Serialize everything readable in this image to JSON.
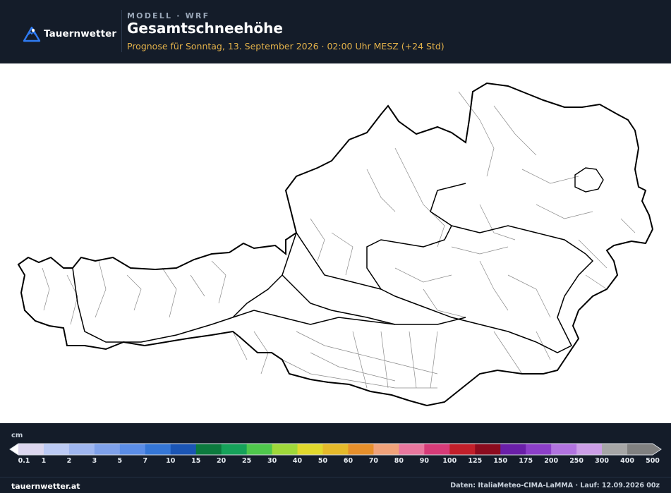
{
  "header": {
    "brand": "Tauernwetter",
    "model_label": "MODELL · WRF",
    "title": "Gesamtschneehöhe",
    "subtitle": "Prognose für Sonntag, 13. September 2026 · 02:00 Uhr MESZ  (+24 Std)"
  },
  "legend": {
    "unit": "cm",
    "ticks": [
      "0.1",
      "1",
      "2",
      "3",
      "5",
      "7",
      "10",
      "15",
      "20",
      "25",
      "30",
      "40",
      "50",
      "60",
      "70",
      "80",
      "90",
      "100",
      "125",
      "150",
      "175",
      "200",
      "250",
      "300",
      "400",
      "500"
    ],
    "colors": [
      "#dcd6ee",
      "#bccaf4",
      "#9fb6ef",
      "#7fa1ea",
      "#5b8de6",
      "#3576d6",
      "#1b55b4",
      "#0c7a3e",
      "#16a25a",
      "#4fc74c",
      "#9fd83a",
      "#e1d82c",
      "#e5b92a",
      "#e68f2b",
      "#f0a27a",
      "#e8779e",
      "#d63b78",
      "#c21f2a",
      "#8c0b1e",
      "#6a1fa8",
      "#8c3fc8",
      "#b173df",
      "#cb9ee6",
      "#a6a6a6",
      "#808080"
    ]
  },
  "footer": {
    "left": "tauernwetter.at",
    "right": "Daten: ItaliaMeteo-CIMA-LaMMA · Lauf: 12.09.2026 00z"
  }
}
